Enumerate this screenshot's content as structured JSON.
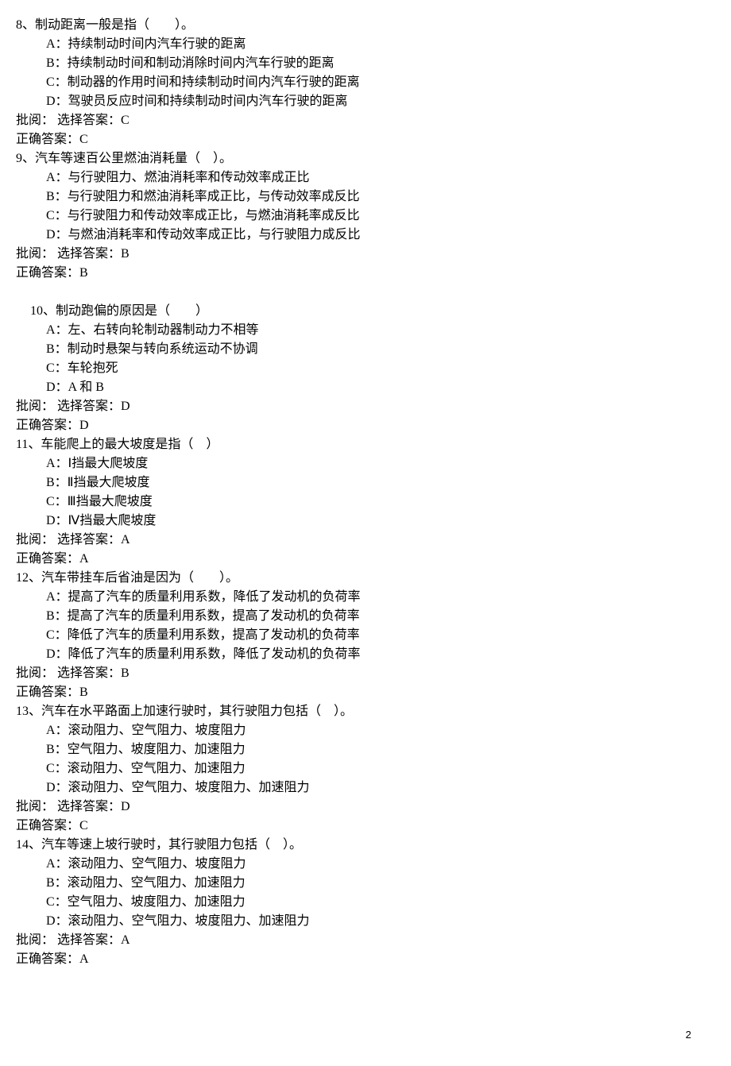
{
  "page_number": "2",
  "questions": [
    {
      "stem": "8、制动距离一般是指（　　）。",
      "options": [
        "A：持续制动时间内汽车行驶的距离",
        "B：持续制动时间和制动消除时间内汽车行驶的距离",
        "C：制动器的作用时间和持续制动时间内汽车行驶的距离",
        "D：驾驶员反应时间和持续制动时间内汽车行驶的距离"
      ],
      "review": "批阅：  选择答案：C",
      "correct": "正确答案：C",
      "indent": false,
      "gap_before": false
    },
    {
      "stem": "9、汽车等速百公里燃油消耗量（　）。",
      "options": [
        "A：与行驶阻力、燃油消耗率和传动效率成正比",
        "B：与行驶阻力和燃油消耗率成正比，与传动效率成反比",
        "C：与行驶阻力和传动效率成正比，与燃油消耗率成反比",
        "D：与燃油消耗率和传动效率成正比，与行驶阻力成反比"
      ],
      "review": "批阅：  选择答案：B",
      "correct": "正确答案：B",
      "indent": false,
      "gap_before": false
    },
    {
      "stem": "10、制动跑偏的原因是（　　）",
      "options": [
        "A：左、右转向轮制动器制动力不相等",
        "B：制动时悬架与转向系统运动不协调",
        "C：车轮抱死",
        "D：A 和 B"
      ],
      "review": "批阅：  选择答案：D",
      "correct": "正确答案：D",
      "indent": true,
      "gap_before": true
    },
    {
      "stem": "11、车能爬上的最大坡度是指（　）",
      "options": [
        "A：Ⅰ挡最大爬坡度",
        "B：Ⅱ挡最大爬坡度",
        "C：Ⅲ挡最大爬坡度",
        "D：Ⅳ挡最大爬坡度"
      ],
      "review": "批阅：  选择答案：A",
      "correct": "正确答案：A",
      "indent": false,
      "gap_before": false
    },
    {
      "stem": "12、汽车带挂车后省油是因为（　　）。",
      "options": [
        "A：提高了汽车的质量利用系数，降低了发动机的负荷率",
        "B：提高了汽车的质量利用系数，提高了发动机的负荷率",
        "C：降低了汽车的质量利用系数，提高了发动机的负荷率",
        "D：降低了汽车的质量利用系数，降低了发动机的负荷率"
      ],
      "review": "批阅：  选择答案：B",
      "correct": "正确答案：B",
      "indent": false,
      "gap_before": false
    },
    {
      "stem": "13、汽车在水平路面上加速行驶时，其行驶阻力包括（　）。",
      "options": [
        "A：滚动阻力、空气阻力、坡度阻力",
        "B：空气阻力、坡度阻力、加速阻力",
        "C：滚动阻力、空气阻力、加速阻力",
        "D：滚动阻力、空气阻力、坡度阻力、加速阻力"
      ],
      "review": "批阅：  选择答案：D",
      "correct": "正确答案：C",
      "indent": false,
      "gap_before": false
    },
    {
      "stem": "14、汽车等速上坡行驶时，其行驶阻力包括（　）。",
      "options": [
        "A：滚动阻力、空气阻力、坡度阻力",
        "B：滚动阻力、空气阻力、加速阻力",
        "C：空气阻力、坡度阻力、加速阻力",
        "D：滚动阻力、空气阻力、坡度阻力、加速阻力"
      ],
      "review": "批阅：  选择答案：A",
      "correct": "正确答案：A",
      "indent": false,
      "gap_before": false
    }
  ]
}
